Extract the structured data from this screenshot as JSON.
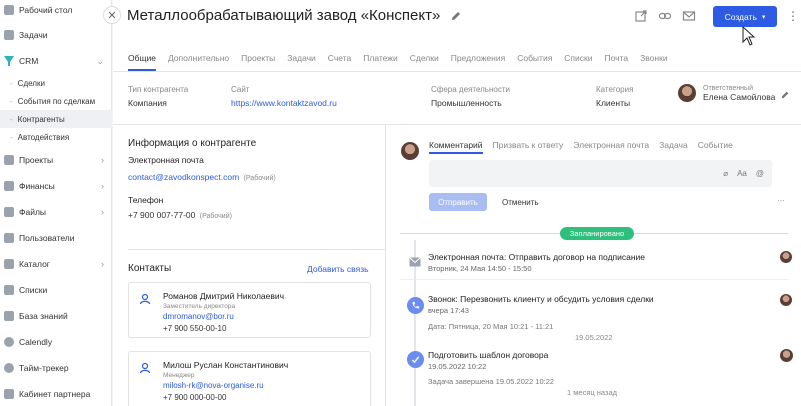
{
  "sidebar": {
    "items": [
      {
        "label": "Рабочий стол",
        "icon": "desktop-icon"
      },
      {
        "label": "Задачи",
        "icon": "tasks-icon"
      },
      {
        "label": "CRM",
        "icon": "crm-icon",
        "expanded": true
      },
      {
        "label": "Проекты",
        "icon": "projects-icon"
      },
      {
        "label": "Финансы",
        "icon": "finance-icon"
      },
      {
        "label": "Файлы",
        "icon": "files-icon"
      },
      {
        "label": "Пользователи",
        "icon": "users-icon"
      },
      {
        "label": "Каталог",
        "icon": "catalog-icon"
      },
      {
        "label": "Списки",
        "icon": "lists-icon"
      },
      {
        "label": "База знаний",
        "icon": "knowledge-base-icon"
      },
      {
        "label": "Calendly",
        "icon": "calendly-icon"
      },
      {
        "label": "Тайм-трекер",
        "icon": "time-tracker-icon"
      },
      {
        "label": "Кабинет партнера",
        "icon": "partner-cabinet-icon"
      }
    ],
    "crm_sub": [
      "Сделки",
      "События по сделкам",
      "Контрагенты",
      "Автодействия"
    ]
  },
  "header": {
    "title": "Металлообрабатывающий завод «Конспект»",
    "create_label": "Создать"
  },
  "tabs": [
    "Общие",
    "Дополнительно",
    "Проекты",
    "Задачи",
    "Счета",
    "Платежи",
    "Сделки",
    "Предложения",
    "События",
    "Списки",
    "Почта",
    "Звонки"
  ],
  "summary": {
    "type_label": "Тип контрагента",
    "type_value": "Компания",
    "site_label": "Сайт",
    "site_value": "https://www.kontaktzavod.ru",
    "sphere_label": "Сфера деятельности",
    "sphere_value": "Промышленность",
    "category_label": "Категория",
    "category_value": "Клиенты",
    "responsible_label": "Ответственный",
    "responsible_value": "Елена Самойлова"
  },
  "contact_info": {
    "title": "Информация о контрагенте",
    "email_label": "Электронная почта",
    "email_value": "contact@zavodkonspect.com",
    "email_type": "(Рабочий)",
    "phone_label": "Телефон",
    "phone_value": "+7 900 007-77-00",
    "phone_type": "(Рабочий)"
  },
  "contacts": {
    "title": "Контакты",
    "add_label": "Добавить связь",
    "items": [
      {
        "name": "Романов Дмитрий Николаевич",
        "position": "Заместитель директора",
        "email": "dmromanov@bor.ru",
        "phone": "+7 900 550-00-10"
      },
      {
        "name": "Милош Руслан Константинович",
        "position": "Менеджер",
        "email": "milosh-rk@nova-organise.ru",
        "phone": "+7 900 000-00-00"
      }
    ]
  },
  "composer": {
    "tabs": [
      "Комментарий",
      "Призвать к ответу",
      "Электронная почта",
      "Задача",
      "Событие"
    ],
    "send_label": "Отправить",
    "cancel_label": "Отменить",
    "more_label": "···"
  },
  "timeline": {
    "planned_label": "Запланировано",
    "events": [
      {
        "title": "Электронная почта: Отправить договор на подписание",
        "sub": "Вторник, 24 Мая 14:50 - 15:50"
      },
      {
        "title": "Звонок: Перезвонить клиенту и обсудить условия сделки",
        "sub": "вчера 17:43",
        "note": "Дата: Пятница, 20 Мая 10:21 - 11:21"
      },
      {
        "title": "Подготовить шаблон договора",
        "sub": "19.05.2022 10:22",
        "note": "Задача завершена 19.05.2022 10:22"
      }
    ],
    "date_sep_1": "19.05.2022",
    "date_sep_2": "1 месяц назад"
  },
  "colors": {
    "accent": "#2d5be3",
    "planned": "#2fbf7d",
    "event_icon": "#6b8cf0"
  }
}
